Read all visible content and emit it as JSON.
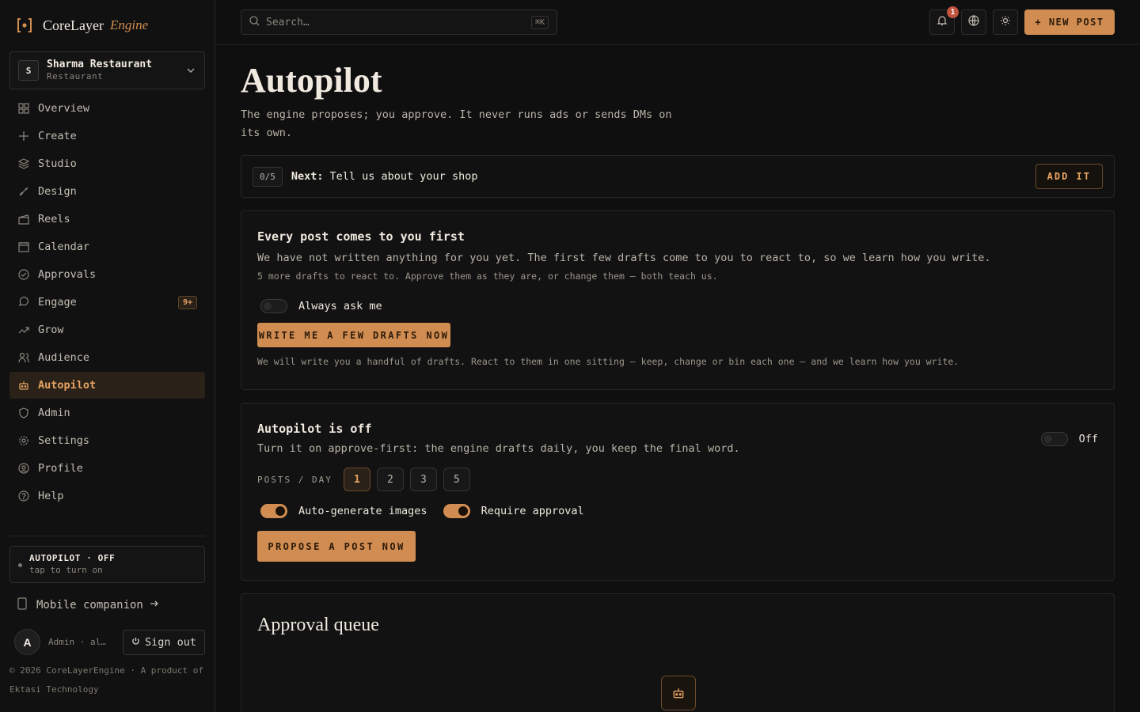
{
  "brand": {
    "name": "CoreLayer",
    "sub": "Engine"
  },
  "workspace": {
    "initial": "S",
    "name": "Sharma Restaurant",
    "type": "Restaurant"
  },
  "nav": [
    {
      "label": "Overview",
      "icon": "grid-icon"
    },
    {
      "label": "Create",
      "icon": "plus-icon"
    },
    {
      "label": "Studio",
      "icon": "layers-icon"
    },
    {
      "label": "Design",
      "icon": "brush-icon"
    },
    {
      "label": "Reels",
      "icon": "clapper-icon"
    },
    {
      "label": "Calendar",
      "icon": "calendar-icon"
    },
    {
      "label": "Approvals",
      "icon": "check-circle-icon"
    },
    {
      "label": "Engage",
      "icon": "chat-icon",
      "badge": "9+"
    },
    {
      "label": "Grow",
      "icon": "trend-icon"
    },
    {
      "label": "Audience",
      "icon": "users-icon"
    },
    {
      "label": "Autopilot",
      "icon": "robot-icon",
      "active": true
    },
    {
      "label": "Admin",
      "icon": "shield-icon"
    },
    {
      "label": "Settings",
      "icon": "gear-icon"
    },
    {
      "label": "Profile",
      "icon": "user-circle-icon"
    },
    {
      "label": "Help",
      "icon": "help-icon"
    }
  ],
  "autopilot_status": {
    "title": "AUTOPILOT · OFF",
    "sub": "tap to turn on"
  },
  "mobile": {
    "label": "Mobile companion"
  },
  "user": {
    "initial": "A",
    "meta": "Admin · al…",
    "signout": "Sign out"
  },
  "footer": {
    "line1": "© 2026 CoreLayerEngine · A product of",
    "line2": "Ektasi Technology"
  },
  "topbar": {
    "search_placeholder": "Search…",
    "search_kbd": "⌘K",
    "notif_count": "1",
    "new_post": "+ NEW POST"
  },
  "page": {
    "title": "Autopilot",
    "subtitle": "The engine proposes; you approve. It never runs ads or sends DMs on its own."
  },
  "next": {
    "count": "0/5",
    "label": "Next:",
    "text": "Tell us about your shop",
    "action": "ADD IT"
  },
  "card1": {
    "title": "Every post comes to you first",
    "desc": "We have not written anything for you yet. The first few drafts come to you to react to, so we learn how you write.",
    "note": "5 more drafts to react to. Approve them as they are, or change them — both teach us.",
    "toggle_label": "Always ask me",
    "button": "WRITE ME A FEW DRAFTS NOW",
    "foot": "We will write you a handful of drafts. React to them in one sitting — keep, change or bin each one — and we learn how you write."
  },
  "card2": {
    "title": "Autopilot is off",
    "desc": "Turn it on approve-first: the engine drafts daily, you keep the final word.",
    "state_label": "Off",
    "posts_label": "POSTS / DAY",
    "options": [
      "1",
      "2",
      "3",
      "5"
    ],
    "selected": "1",
    "images_label": "Auto-generate images",
    "approval_label": "Require approval",
    "button": "PROPOSE A POST NOW"
  },
  "card3": {
    "title": "Approval queue"
  },
  "colors": {
    "accent": "#d18d51",
    "bg": "#0f0f0f",
    "panel": "#121212",
    "badge": "#c2533f"
  }
}
